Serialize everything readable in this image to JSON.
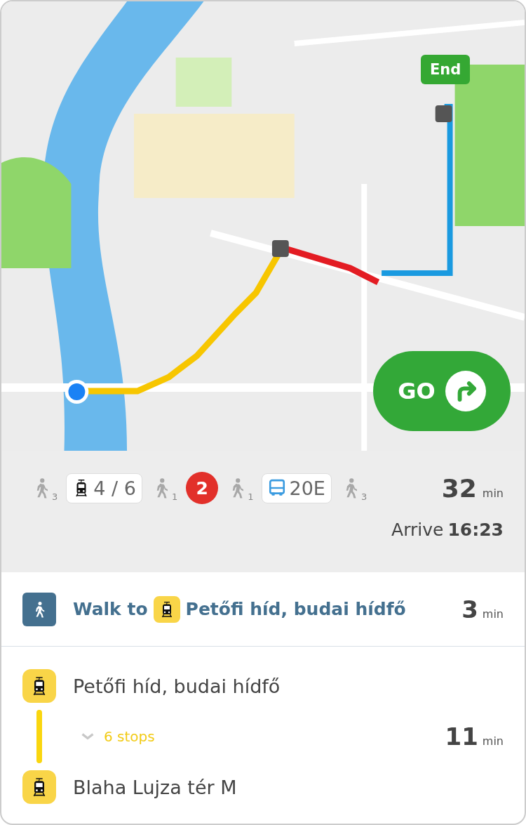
{
  "map": {
    "kind": "picture",
    "end_label": "End",
    "go_button": {
      "label": "GO"
    }
  },
  "summary": {
    "legs": [
      {
        "kind": "walk",
        "minutes": "3"
      },
      {
        "kind": "tram",
        "line": "4 / 6"
      },
      {
        "kind": "walk",
        "minutes": "1"
      },
      {
        "kind": "metro",
        "line": "2"
      },
      {
        "kind": "walk",
        "minutes": "1"
      },
      {
        "kind": "bus",
        "line": "20E"
      },
      {
        "kind": "walk",
        "minutes": "3"
      }
    ],
    "duration": "32",
    "duration_unit": "min",
    "arrive_label": "Arrive",
    "arrive_time": "16:23"
  },
  "walk_step": {
    "text": "Walk to",
    "stop": "Petőfi híd, budai hídfő",
    "duration": "3",
    "unit": "min"
  },
  "tram_leg": {
    "from": "Petőfi híd, budai hídfő",
    "stops": "6 stops",
    "expanded": false,
    "duration": "11",
    "unit": "min",
    "to": "Blaha Lujza tér M"
  }
}
